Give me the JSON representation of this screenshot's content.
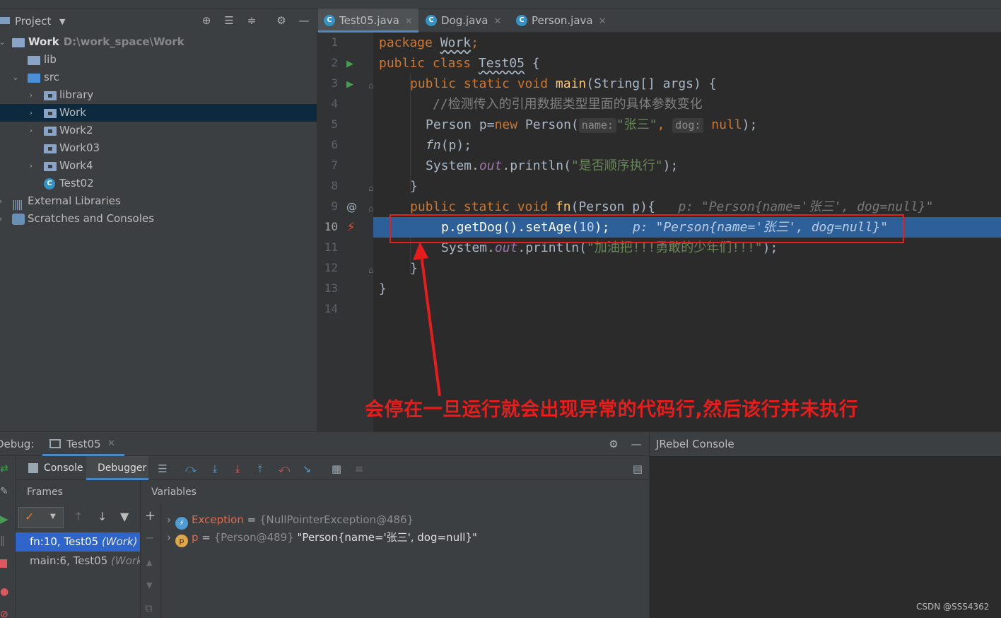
{
  "project": {
    "title": "Project",
    "tree": [
      {
        "label": "Work",
        "path": "D:\\work_space\\Work"
      },
      {
        "label": "lib"
      },
      {
        "label": "src"
      },
      {
        "label": "library"
      },
      {
        "label": "Work"
      },
      {
        "label": "Work2"
      },
      {
        "label": "Work03"
      },
      {
        "label": "Work4"
      },
      {
        "label": "Test02"
      },
      {
        "label": "External Libraries"
      },
      {
        "label": "Scratches and Consoles"
      }
    ]
  },
  "editor": {
    "tabs": [
      {
        "label": "Test05.java"
      },
      {
        "label": "Dog.java"
      },
      {
        "label": "Person.java"
      }
    ],
    "line_numbers": [
      "1",
      "2",
      "3",
      "4",
      "5",
      "6",
      "7",
      "8",
      "9",
      "10",
      "11",
      "12",
      "13",
      "14"
    ],
    "code": {
      "l1_kw": "package",
      "l1_name": "Work",
      "l1_end": ";",
      "l2_kw": "public class",
      "l2_name": "Test05",
      "l2_end": " {",
      "l3_kw": "public static void",
      "l3_fn": "main",
      "l3_rest": "(String[] args) {",
      "l4_comment": "//检测传入的引用数据类型里面的具体参数变化",
      "l5_a": "Person p=",
      "l5_new": "new",
      "l5_b": " Person(",
      "l5_hint1": "name:",
      "l5_str": "\"张三\"",
      "l5_comma": ",",
      "l5_hint2": "dog:",
      "l5_null": "null",
      "l5_end": ");",
      "l6_fn": "fn",
      "l6_rest": "(p);",
      "l7_a": "System.",
      "l7_out": "out",
      "l7_b": ".println(",
      "l7_str": "\"是否顺序执行\"",
      "l7_end": ");",
      "l8": "}",
      "l9_kw": "public static void",
      "l9_fn": "fn",
      "l9_rest": "(Person p){",
      "l9_inline": "p: \"Person{name='张三', dog=null}\"",
      "l10_a": "p.getDog().setAge(",
      "l10_num": "10",
      "l10_end": ");",
      "l10_inline": "p: \"Person{name='张三', dog=null}\"",
      "l11_a": "System.",
      "l11_out": "out",
      "l11_b": ".println(",
      "l11_str": "\"加油把!!!勇敢的少年们!!!\"",
      "l11_end": ");",
      "l12": "}",
      "l13": "}"
    }
  },
  "annotation": {
    "text": "会停在一旦运行就会出现异常的代码行,然后该行并未执行"
  },
  "debug": {
    "label": "Debug:",
    "session_tab": "Test05",
    "tabs": {
      "console": "Console",
      "debugger": "Debugger"
    },
    "frames_title": "Frames",
    "variables_title": "Variables",
    "frames": [
      {
        "label": "fn:10, Test05",
        "pkg": "(Work)"
      },
      {
        "label": "main:6, Test05",
        "pkg": "(Work)"
      }
    ],
    "variables": [
      {
        "name": "Exception",
        "eq": " = ",
        "type": "{NullPointerException@486}",
        "value": ""
      },
      {
        "name": "p",
        "eq": " = ",
        "type": "{Person@489}",
        "value": " \"Person{name='张三', dog=null}\""
      }
    ]
  },
  "jrebel": {
    "title": "JRebel Console"
  },
  "watermark": "CSDN @SSS4362",
  "colors": {
    "keyword": "#cc7832",
    "string": "#6a8759",
    "highlight_line": "#2d6099",
    "annotation_red": "#e51d1d"
  }
}
